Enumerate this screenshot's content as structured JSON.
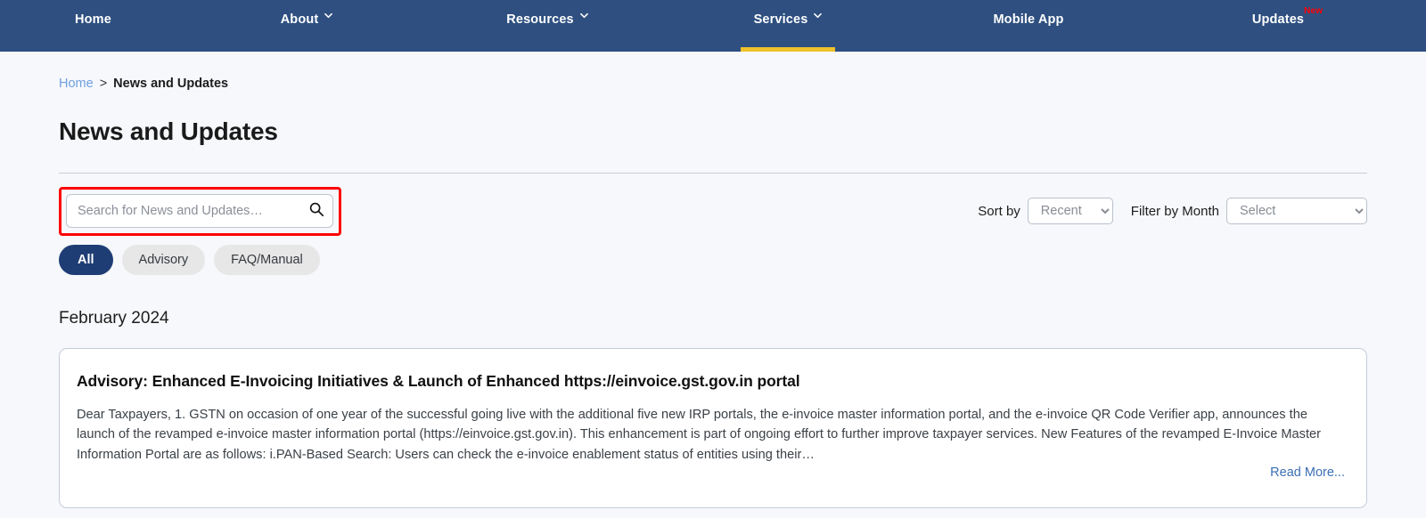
{
  "nav": {
    "items": [
      {
        "label": "Home",
        "has_caret": false,
        "active": false,
        "badge": null
      },
      {
        "label": "About",
        "has_caret": true,
        "active": false,
        "badge": null
      },
      {
        "label": "Resources",
        "has_caret": true,
        "active": false,
        "badge": null
      },
      {
        "label": "Services",
        "has_caret": true,
        "active": true,
        "badge": null
      },
      {
        "label": "Mobile App",
        "has_caret": false,
        "active": false,
        "badge": null
      },
      {
        "label": "Updates",
        "has_caret": false,
        "active": false,
        "badge": "New"
      }
    ],
    "background_color": "#2e4f80",
    "active_underline_color": "#efc12a",
    "badge_color": "#ff0000"
  },
  "breadcrumb": {
    "home_label": "Home",
    "separator": ">",
    "current_label": "News and Updates"
  },
  "page": {
    "title": "News and Updates"
  },
  "search": {
    "placeholder": "Search for News and Updates…",
    "value": "",
    "icon": "search-icon",
    "highlight_color": "#ff0000"
  },
  "sort": {
    "label": "Sort by",
    "selected": "Recent",
    "options": [
      "Recent"
    ]
  },
  "month_filter": {
    "label": "Filter by Month",
    "selected": "Select",
    "options": [
      "Select"
    ]
  },
  "category_pills": [
    {
      "label": "All",
      "active": true
    },
    {
      "label": "Advisory",
      "active": false
    },
    {
      "label": "FAQ/Manual",
      "active": false
    }
  ],
  "month_section": {
    "heading": "February 2024"
  },
  "news_card": {
    "title": "Advisory: Enhanced E-Invoicing Initiatives & Launch of Enhanced https://einvoice.gst.gov.in portal",
    "body": "Dear Taxpayers, 1. GSTN on occasion of one year of the successful going live with the additional five new IRP portals, the e-invoice master information portal, and the e-invoice QR Code Verifier app, announces the launch of the revamped e-invoice master information portal (https://einvoice.gst.gov.in). This enhancement is part of ongoing effort to further improve taxpayer services. New Features of the revamped E-Invoice Master Information Portal are as follows: i.PAN-Based Search: Users can check the e-invoice enablement status of entities using their…",
    "read_more_label": "Read More..."
  }
}
